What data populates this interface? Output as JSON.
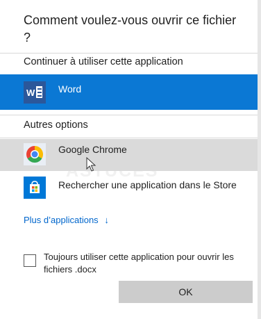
{
  "dialog": {
    "title": "Comment voulez-vous ouvrir ce fichier ?"
  },
  "continue_section": {
    "heading": "Continuer à utiliser cette application",
    "app": {
      "name": "Word",
      "icon": "word-icon",
      "color": "#2b579a",
      "icon_letter": "W"
    }
  },
  "other_section": {
    "heading": "Autres options",
    "apps": [
      {
        "name": "Google Chrome",
        "icon": "chrome-icon"
      },
      {
        "name": "Rechercher une application dans le Store",
        "icon": "store-icon"
      }
    ]
  },
  "more_apps": {
    "label": "Plus d’applications",
    "icon": "arrow-down-icon"
  },
  "always_use": {
    "checked": false,
    "label": "Toujours utiliser cette application pour ouvrir les fichiers .docx"
  },
  "ok_button": {
    "label": "OK"
  },
  "watermark": {
    "text": "ASTUCES"
  },
  "colors": {
    "accent": "#0b78d4",
    "hover": "#dadada",
    "link": "#0066cc",
    "button": "#cccccc"
  }
}
